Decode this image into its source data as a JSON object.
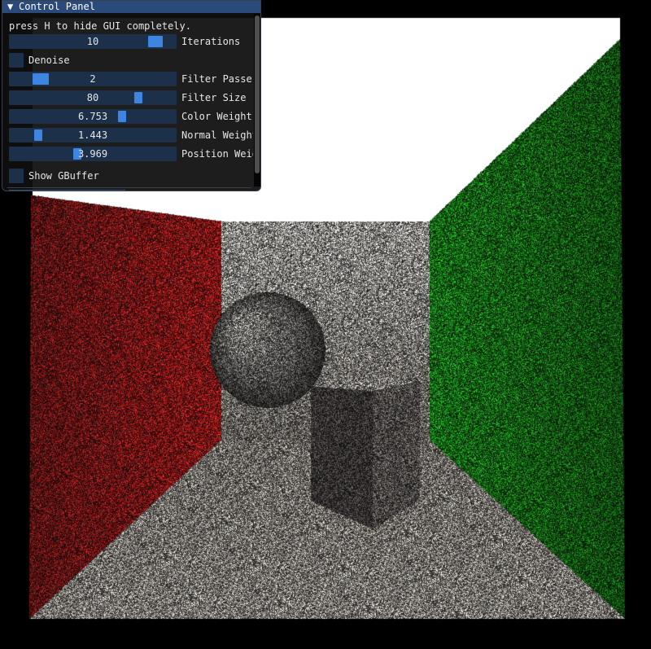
{
  "panel": {
    "title": "Control Panel",
    "collapse_arrow": "▼",
    "hint": "press H to hide GUI completely."
  },
  "controls": {
    "iterations": {
      "label": "Iterations",
      "value": "10",
      "fraction": 0.92
    },
    "denoise": {
      "label": "Denoise",
      "checked": false
    },
    "filter_passes": {
      "label": "Filter Passes",
      "value": "2",
      "fraction": 0.15
    },
    "filter_size": {
      "label": "Filter Size",
      "value": "80",
      "fraction": 0.79
    },
    "color_weight": {
      "label": "Color Weight",
      "value": "6.753",
      "fraction": 0.69
    },
    "normal_weight": {
      "label": "Normal Weight",
      "value": "1.443",
      "fraction": 0.15
    },
    "position_weight": {
      "label": "Position Weight",
      "value": "3.969",
      "fraction": 0.4
    },
    "show_gbuffer": {
      "label": "Show GBuffer",
      "checked": false
    }
  },
  "colors": {
    "title_bar": "#294a7a",
    "slider_bg": "#1d3049",
    "slider_grab": "#3d85e0",
    "left_wall": "#b82e2e",
    "right_wall": "#2e9a2e",
    "light": "#ffffff"
  },
  "icons": {
    "collapse": "triangle-down-icon"
  }
}
